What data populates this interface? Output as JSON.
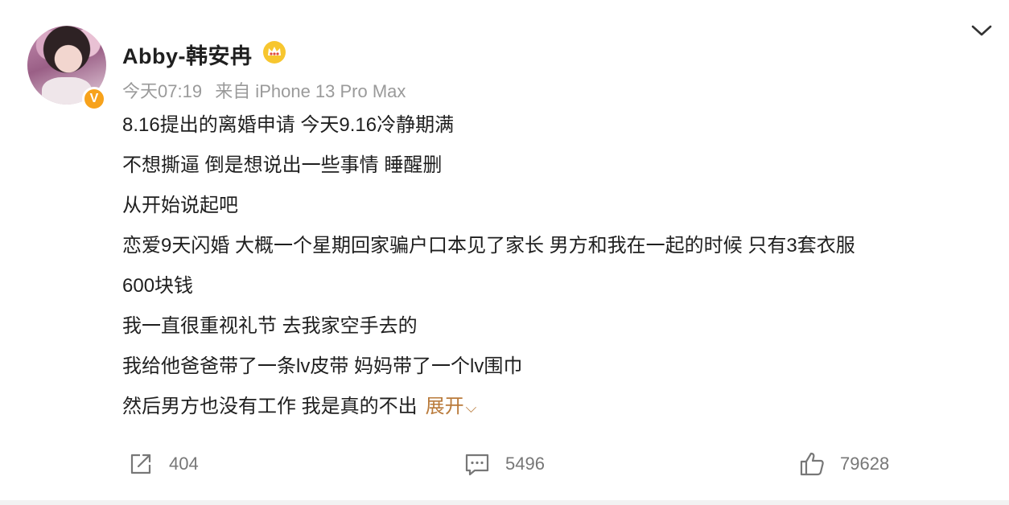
{
  "header": {
    "username": "Abby-韩安冉",
    "time": "今天07:19",
    "source": "来自 iPhone 13 Pro Max"
  },
  "post": {
    "lines": [
      "8.16提出的离婚申请 今天9.16冷静期满",
      "不想撕逼 倒是想说出一些事情 睡醒删",
      "从开始说起吧",
      "恋爱9天闪婚 大概一个星期回家骗户口本见了家长 男方和我在一起的时候 只有3套衣服",
      "600块钱",
      "我一直很重视礼节 去我家空手去的",
      "我给他爸爸带了一条lv皮带 妈妈带了一个lv围巾",
      "然后男方也没有工作 我是真的不出"
    ],
    "expand_label": "展开"
  },
  "actions": {
    "repost_count": "404",
    "comment_count": "5496",
    "like_count": "79628"
  },
  "colors": {
    "accent": "#b97a3a",
    "meta": "#9a9a9a",
    "badge": "#f7a21b"
  },
  "icons": {
    "menu": "chevron-down-icon",
    "crown": "crown-icon",
    "verified": "verified-badge-icon",
    "repost": "repost-icon",
    "comment": "comment-icon",
    "like": "thumbs-up-icon"
  }
}
